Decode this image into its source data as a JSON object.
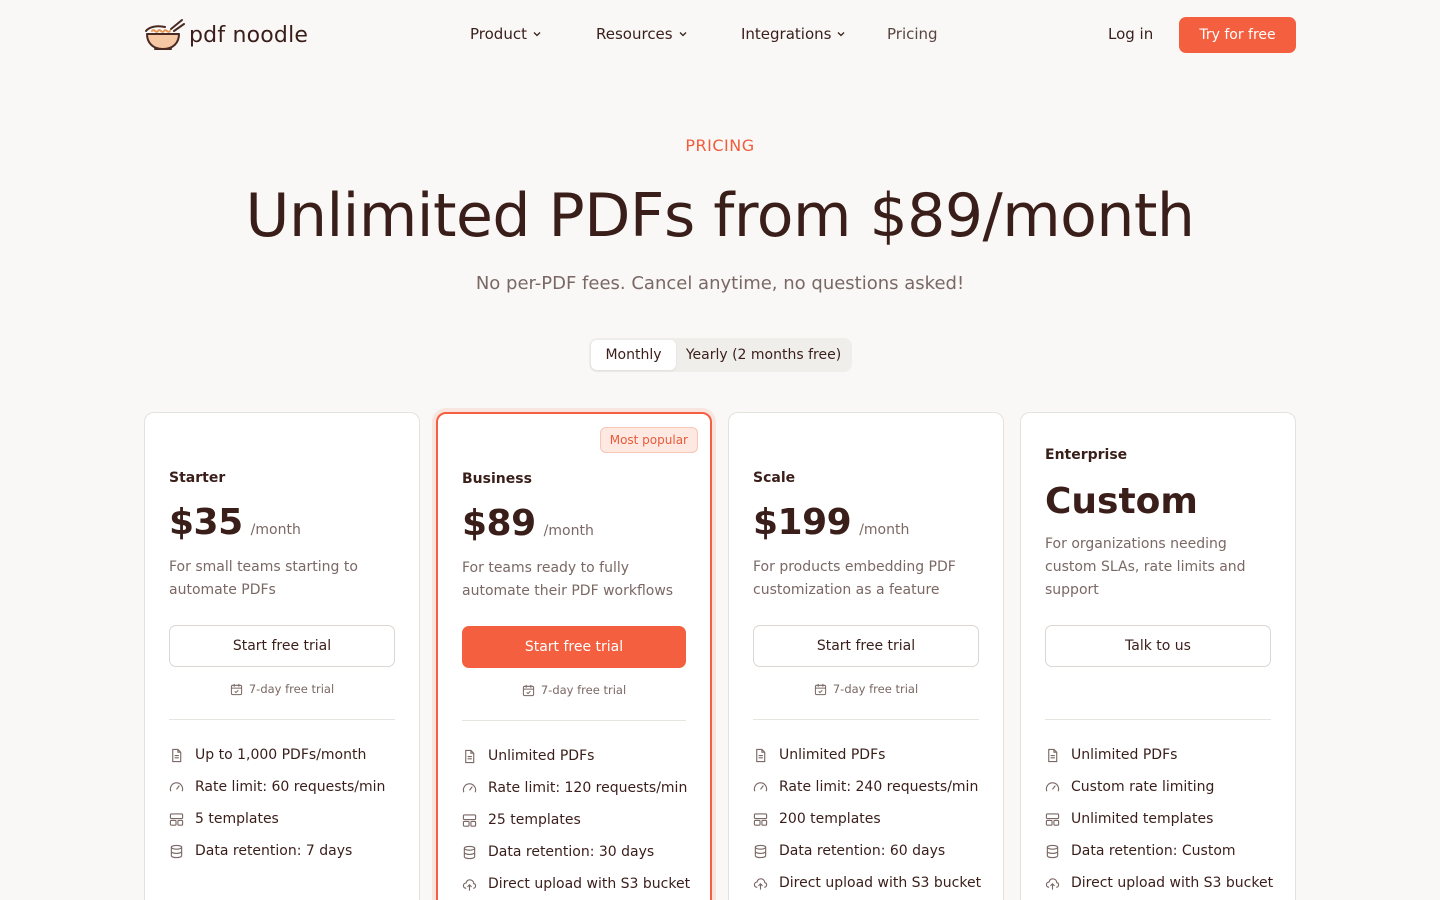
{
  "brand": {
    "name": "pdf noodle"
  },
  "nav": {
    "items": [
      {
        "label": "Product",
        "dropdown": true
      },
      {
        "label": "Resources",
        "dropdown": true
      },
      {
        "label": "Integrations",
        "dropdown": true
      },
      {
        "label": "Pricing",
        "dropdown": false
      }
    ],
    "login": "Log in",
    "cta": "Try for free"
  },
  "hero": {
    "eyebrow": "PRICING",
    "headline": "Unlimited PDFs from $89/month",
    "subhead": "No per-PDF fees. Cancel anytime, no questions asked!"
  },
  "billing_toggle": {
    "monthly": "Monthly",
    "yearly": "Yearly (2 months free)",
    "selected": "Monthly"
  },
  "colors": {
    "accent": "#f35f3f",
    "text": "#3a1e1a",
    "muted": "#7a6864",
    "background": "#f9f8f6"
  },
  "plans": [
    {
      "name": "Starter",
      "price": "$35",
      "period": "/month",
      "description": "For small teams starting to automate PDFs",
      "cta": "Start free trial",
      "trial": "7-day free trial",
      "features": [
        "Up to 1,000 PDFs/month",
        "Rate limit: 60 requests/min",
        "5 templates",
        "Data retention: 7 days"
      ]
    },
    {
      "name": "Business",
      "price": "$89",
      "period": "/month",
      "badge": "Most popular",
      "description": "For teams ready to fully automate their PDF workflows",
      "cta": "Start free trial",
      "trial": "7-day free trial",
      "features": [
        "Unlimited PDFs",
        "Rate limit: 120 requests/min",
        "25 templates",
        "Data retention: 30 days",
        "Direct upload with S3 bucket"
      ]
    },
    {
      "name": "Scale",
      "price": "$199",
      "period": "/month",
      "description": "For products embedding PDF customization as a feature",
      "cta": "Start free trial",
      "trial": "7-day free trial",
      "features": [
        "Unlimited PDFs",
        "Rate limit: 240 requests/min",
        "200 templates",
        "Data retention: 60 days",
        "Direct upload with S3 bucket"
      ]
    },
    {
      "name": "Enterprise",
      "price": "Custom",
      "description": "For organizations needing custom SLAs, rate limits and support",
      "cta": "Talk to us",
      "features": [
        "Unlimited PDFs",
        "Custom rate limiting",
        "Unlimited templates",
        "Data retention: Custom",
        "Direct upload with S3 bucket"
      ]
    }
  ],
  "feature_icons": [
    "document-icon",
    "gauge-icon",
    "template-icon",
    "database-icon",
    "cloud-upload-icon"
  ]
}
